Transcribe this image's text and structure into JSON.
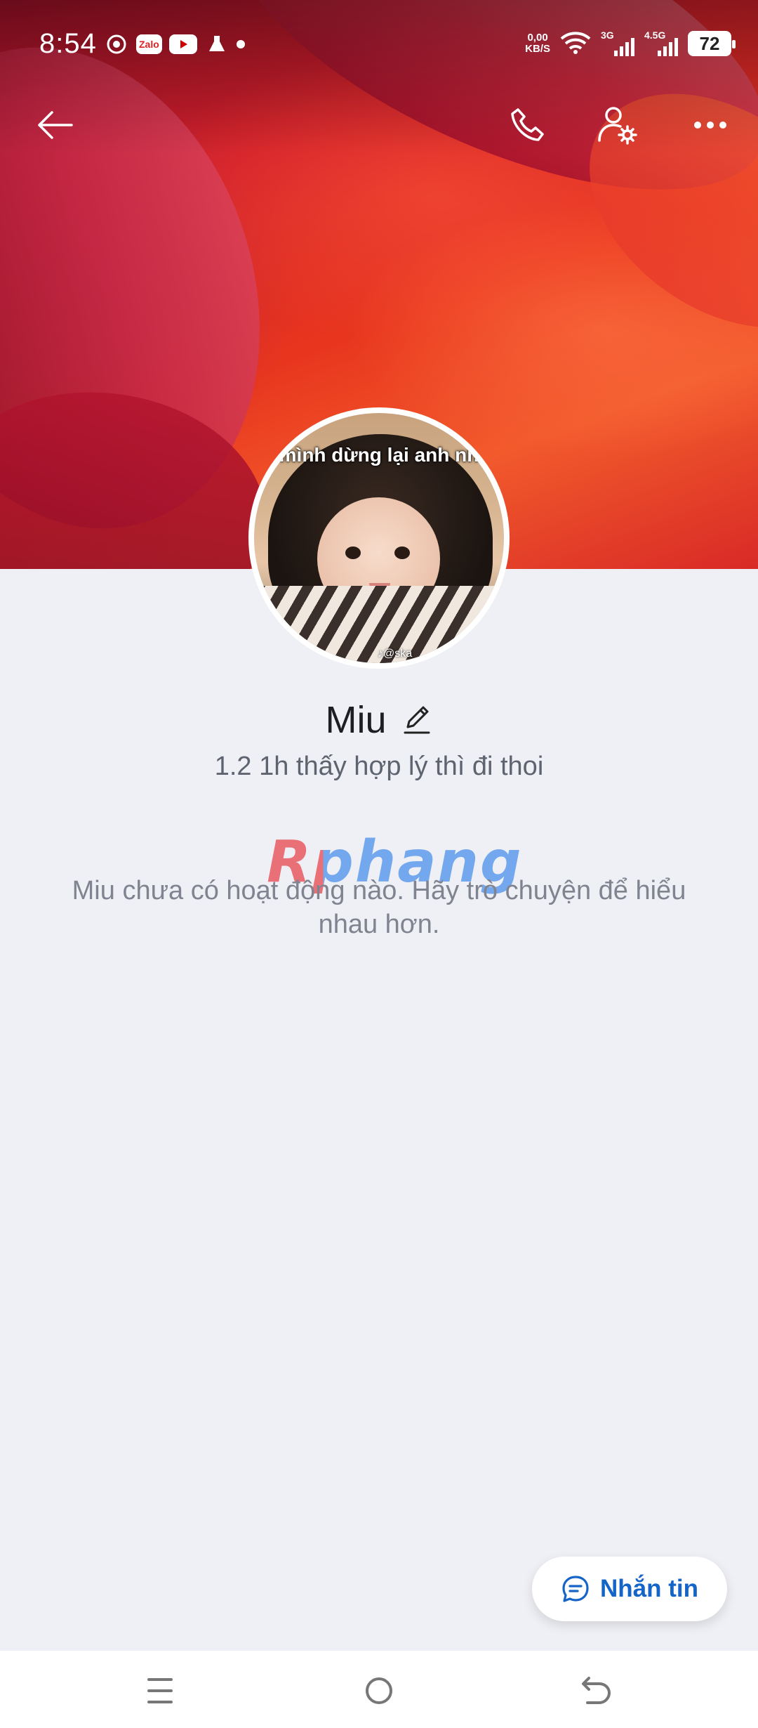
{
  "status_bar": {
    "time": "8:54",
    "notification_icons": [
      "chrome-icon",
      "zalo-icon",
      "youtube-icon",
      "lab-flask-icon",
      "dot-icon"
    ],
    "zalo_text": "Zalo",
    "net_speed_value": "0,00",
    "net_speed_unit": "KB/S",
    "network_1": "3G",
    "network_2": "4.5G",
    "battery": "72"
  },
  "top_nav": {
    "back_icon": "arrow-left-icon",
    "call_icon": "phone-icon",
    "settings_icon": "user-settings-icon",
    "more_icon": "more-horizontal-icon"
  },
  "avatar": {
    "caption": "mình dừng lại anh nh",
    "tag": "♪@ska"
  },
  "profile": {
    "name": "Miu",
    "bio": "1.2 1h thấy hợp lý thì đi thoi",
    "empty_state": "Miu chưa có hoạt động nào. Hãy trò chuyện để hiểu nhau hơn."
  },
  "watermark": "Rphang",
  "message_button": {
    "label": "Nhắn tin"
  },
  "colors": {
    "accent": "#1565c8",
    "background": "#eff0f5"
  }
}
